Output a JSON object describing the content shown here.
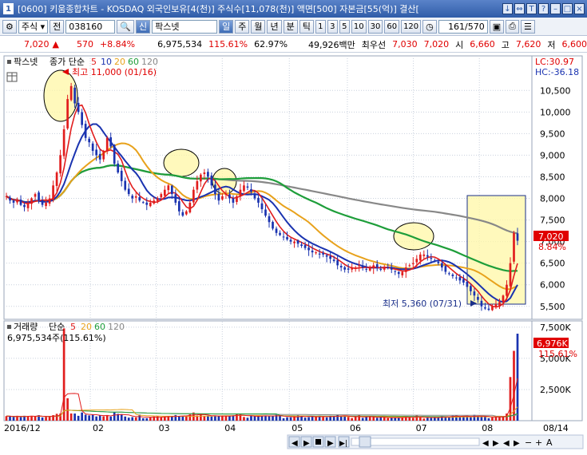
{
  "window": {
    "screen_no": "1",
    "title": "[0600] 키움종합차트 - KOSDAQ 외국인보유[4(천)] 주식수[11,078(천)] 액면[500] 자본금[55(억)] 결산[",
    "buttons": [
      "↓",
      "⇔",
      "T",
      "?",
      "–",
      "□",
      "×"
    ]
  },
  "toolbar": {
    "market": "주식",
    "prev": "전",
    "code": "038160",
    "credit_badge": "신",
    "name": "팍스넷",
    "periods": [
      "일",
      "주",
      "월",
      "년",
      "분",
      "틱"
    ],
    "active_period": "일",
    "intervals": [
      "1",
      "3",
      "5",
      "10",
      "30",
      "60",
      "120"
    ],
    "page_count": "161/570",
    "icons": [
      "save-icon",
      "print-icon",
      "settings-icon"
    ]
  },
  "quote": {
    "price": "7,020",
    "change_arrow": "▲",
    "change": "570",
    "change_pct": "+8.84%",
    "volume": "6,975,534",
    "volume_ratio": "115.61%",
    "turnover": "62.97%",
    "amount": "49,926백만",
    "bid_label": "최우선",
    "bid": "7,030",
    "ask": "7,020",
    "open_label": "시",
    "open": "6,660",
    "high_label": "고",
    "high": "7,620",
    "low_label": "저",
    "low": "6,600"
  },
  "price_panel": {
    "name": "팍스넷",
    "legend": [
      {
        "label": "종가 단순",
        "color": "#000000"
      },
      {
        "label": "5",
        "color": "#e11d1d"
      },
      {
        "label": "10",
        "color": "#1a33b0"
      },
      {
        "label": "20",
        "color": "#e8a21c"
      },
      {
        "label": "60",
        "color": "#1e9e3a"
      },
      {
        "label": "120",
        "color": "#888888"
      }
    ],
    "lc": "LC:30.97",
    "hc": "HC:-36.18",
    "annot_high": "최고 11,000 (01/16)",
    "annot_low": "최저 5,360 (07/31)",
    "price_tag": "7,020",
    "pct_tag": "8.84%"
  },
  "volume_panel": {
    "name": "거래량",
    "legend": [
      {
        "label": "단순",
        "color": "#000000"
      },
      {
        "label": "5",
        "color": "#e11d1d"
      },
      {
        "label": "20",
        "color": "#e8a21c"
      },
      {
        "label": "60",
        "color": "#1e9e3a"
      },
      {
        "label": "120",
        "color": "#888888"
      }
    ],
    "info": "6,975,534주(115.61%)",
    "vol_tag": "6,976K",
    "pct_tag": "115.61%"
  },
  "chart_data": {
    "type": "candlestick",
    "x_ticks": [
      "2016/12",
      "02",
      "03",
      "04",
      "05",
      "06",
      "07",
      "08",
      "08/14"
    ],
    "y_ticks": [
      5500,
      6000,
      6500,
      7000,
      7500,
      8000,
      8500,
      9000,
      9500,
      10000,
      10500
    ],
    "ylim": [
      5200,
      11300
    ],
    "vol_ticks": [
      "7,500K",
      "5,000K",
      "2,500K"
    ],
    "vol_ylim": [
      0,
      8000000
    ],
    "closes": [
      8050,
      7950,
      7900,
      7950,
      7850,
      7800,
      7900,
      8000,
      8100,
      7950,
      7850,
      7900,
      8000,
      8300,
      8600,
      9000,
      9600,
      10300,
      10600,
      10200,
      10000,
      9700,
      9400,
      9300,
      9100,
      9000,
      8900,
      9100,
      9400,
      9200,
      8800,
      8600,
      8400,
      8200,
      8100,
      8000,
      8050,
      7950,
      7900,
      7850,
      7900,
      7950,
      8000,
      8100,
      8200,
      8300,
      8100,
      7900,
      7700,
      7600,
      7700,
      7900,
      8200,
      8400,
      8550,
      8600,
      8500,
      8300,
      8100,
      7950,
      8050,
      8100,
      8000,
      7900,
      8050,
      8200,
      8300,
      8250,
      8150,
      8000,
      7900,
      7750,
      7600,
      7450,
      7300,
      7200,
      7150,
      7100,
      7050,
      7000,
      7000,
      6950,
      6900,
      6850,
      6800,
      6750,
      6750,
      6700,
      6700,
      6650,
      6600,
      6550,
      6450,
      6400,
      6350,
      6350,
      6400,
      6400,
      6450,
      6400,
      6350,
      6400,
      6450,
      6400,
      6350,
      6400,
      6400,
      6350,
      6300,
      6250,
      6300,
      6400,
      6450,
      6500,
      6600,
      6700,
      6700,
      6650,
      6600,
      6550,
      6500,
      6400,
      6300,
      6250,
      6200,
      6150,
      6100,
      6050,
      5950,
      5850,
      5750,
      5650,
      5500,
      5450,
      5420,
      5500,
      5550,
      5600,
      5750,
      6000,
      6500,
      7200,
      7020
    ]
  }
}
